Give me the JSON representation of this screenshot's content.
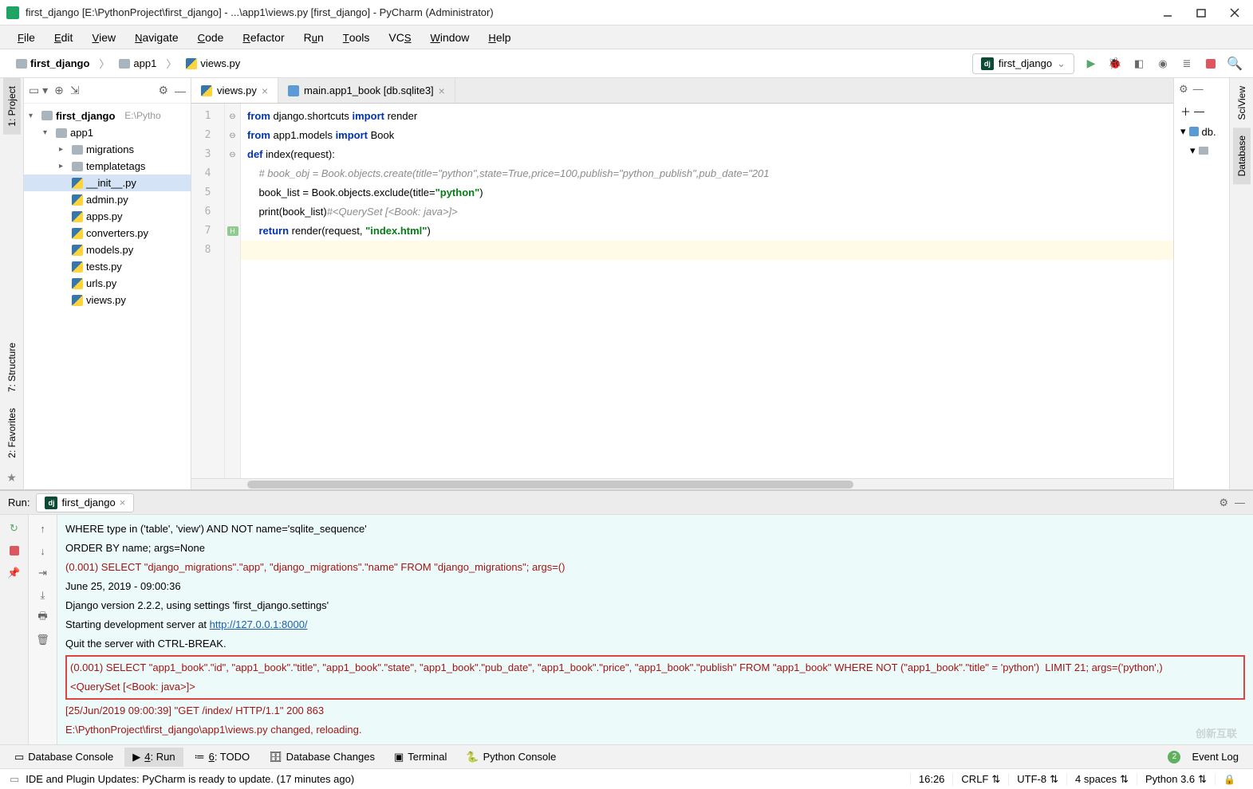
{
  "titlebar": {
    "title": "first_django [E:\\PythonProject\\first_django] - ...\\app1\\views.py [first_django] - PyCharm (Administrator)"
  },
  "menu": [
    "File",
    "Edit",
    "View",
    "Navigate",
    "Code",
    "Refactor",
    "Run",
    "Tools",
    "VCS",
    "Window",
    "Help"
  ],
  "breadcrumbs": {
    "items": [
      "first_django",
      "app1",
      "views.py"
    ]
  },
  "run_config": {
    "name": "first_django"
  },
  "project": {
    "root": "first_django",
    "root_path": "E:\\Pytho",
    "app": "app1",
    "folders": [
      "migrations",
      "templatetags"
    ],
    "files": [
      "__init__.py",
      "admin.py",
      "apps.py",
      "converters.py",
      "models.py",
      "tests.py",
      "urls.py",
      "views.py"
    ]
  },
  "tabs": [
    {
      "label": "views.py",
      "type": "py",
      "active": true
    },
    {
      "label": "main.app1_book [db.sqlite3]",
      "type": "db",
      "active": false
    }
  ],
  "code": {
    "lines": [
      {
        "n": 1,
        "segs": [
          [
            "kw",
            "from"
          ],
          [
            "p",
            " django.shortcuts "
          ],
          [
            "imp",
            "import"
          ],
          [
            "p",
            " render"
          ]
        ]
      },
      {
        "n": 2,
        "segs": [
          [
            "kw",
            "from"
          ],
          [
            "p",
            " app1.models "
          ],
          [
            "imp",
            "import"
          ],
          [
            "p",
            " Book"
          ]
        ]
      },
      {
        "n": 3,
        "segs": [
          [
            "kw",
            "def "
          ],
          [
            "fn",
            "index"
          ],
          [
            "p",
            "(request):"
          ]
        ]
      },
      {
        "n": 4,
        "segs": [
          [
            "p",
            "    "
          ],
          [
            "cmt",
            "# book_obj = Book.objects.create(title=\"python\",state=True,price=100,publish=\"python_publish\",pub_date=\"201"
          ]
        ]
      },
      {
        "n": 5,
        "segs": [
          [
            "p",
            "    book_list = Book.objects.exclude("
          ],
          [
            "fn",
            "title"
          ],
          [
            "p",
            "="
          ],
          [
            "str",
            "\"python\""
          ],
          [
            "p",
            ")"
          ]
        ]
      },
      {
        "n": 6,
        "segs": [
          [
            "p",
            "    print(book_list)"
          ],
          [
            "cmt",
            "#<QuerySet [<Book: java>]>"
          ]
        ]
      },
      {
        "n": 7,
        "segs": [
          [
            "p",
            "    "
          ],
          [
            "kw",
            "return"
          ],
          [
            "p",
            " render(request, "
          ],
          [
            "str",
            "\"index.html\""
          ],
          [
            "p",
            ")"
          ]
        ]
      },
      {
        "n": 8,
        "segs": [
          [
            "p",
            " "
          ]
        ]
      }
    ]
  },
  "run": {
    "label": "Run:",
    "tab": "first_django",
    "lines": [
      {
        "t": "p",
        "v": "        WHERE type in ('table', 'view') AND NOT name='sqlite_sequence'"
      },
      {
        "t": "p",
        "v": "        ORDER BY name; args=None"
      },
      {
        "t": "r",
        "v": "(0.001) SELECT \"django_migrations\".\"app\", \"django_migrations\".\"name\" FROM \"django_migrations\"; args=()"
      },
      {
        "t": "p",
        "v": "June 25, 2019 - 09:00:36"
      },
      {
        "t": "p",
        "v": "Django version 2.2.2, using settings 'first_django.settings'"
      },
      {
        "t": "p",
        "v": "Starting development server at ",
        "link": "http://127.0.0.1:8000/"
      },
      {
        "t": "p",
        "v": "Quit the server with CTRL-BREAK."
      },
      {
        "t": "rb",
        "v": "(0.001) SELECT \"app1_book\".\"id\", \"app1_book\".\"title\", \"app1_book\".\"state\", \"app1_book\".\"pub_date\", \"app1_book\".\"price\", \"app1_book\".\"publish\" FROM \"app1_book\" WHERE NOT (\"app1_book\".\"title\" = 'python')  LIMIT 21; args=('python',)\n<QuerySet [<Book: java>]>"
      },
      {
        "t": "r",
        "v": "[25/Jun/2019 09:00:39] \"GET /index/ HTTP/1.1\" 200 863"
      },
      {
        "t": "r",
        "v": "E:\\PythonProject\\first_django\\app1\\views.py changed, reloading."
      }
    ]
  },
  "bottom_tabs": [
    "Database Console",
    "4: Run",
    "6: TODO",
    "Database Changes",
    "Terminal",
    "Python Console"
  ],
  "event_log": "Event Log",
  "status": {
    "msg": "IDE and Plugin Updates: PyCharm is ready to update. (17 minutes ago)",
    "pos": "16:26",
    "crlf": "CRLF",
    "enc": "UTF-8",
    "indent": "4 spaces",
    "python": "Python 3.6"
  },
  "right_panel": {
    "db": "db."
  },
  "left_tabs": [
    "1: Project",
    "7: Structure",
    "2: Favorites"
  ],
  "right_tabs": [
    "SciView",
    "Database"
  ],
  "watermark": "创新互联"
}
